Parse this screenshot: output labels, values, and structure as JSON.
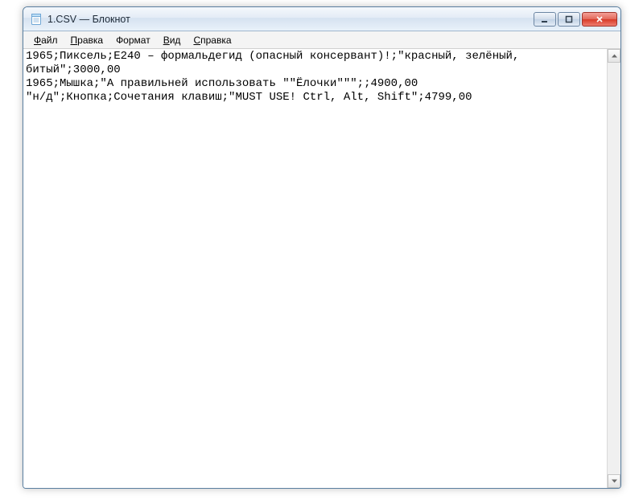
{
  "window": {
    "title": "1.CSV — Блокнот"
  },
  "menubar": {
    "file": {
      "label": "Файл",
      "hotkey_index": 0
    },
    "edit": {
      "label": "Правка",
      "hotkey_index": 0
    },
    "format": {
      "label": "Формат",
      "hotkey_index": -1
    },
    "view": {
      "label": "Вид",
      "hotkey_index": 0
    },
    "help": {
      "label": "Справка",
      "hotkey_index": 0
    }
  },
  "editor": {
    "lines": [
      "1965;Пиксель;E240 – формальдегид (опасный консервант)!;\"красный, зелёный, битый\";3000,00",
      "1965;Мышка;\"А правильней использовать \"\"Ёлочки\"\"\";;4900,00",
      "\"н/д\";Кнопка;Сочетания клавиш;\"MUST USE! Ctrl, Alt, Shift\";4799,00"
    ]
  },
  "icons": {
    "app": "notepad-icon",
    "minimize": "minimize-icon",
    "maximize": "maximize-icon",
    "close": "close-icon",
    "scroll_up": "scroll-up-arrow",
    "scroll_down": "scroll-down-arrow"
  }
}
